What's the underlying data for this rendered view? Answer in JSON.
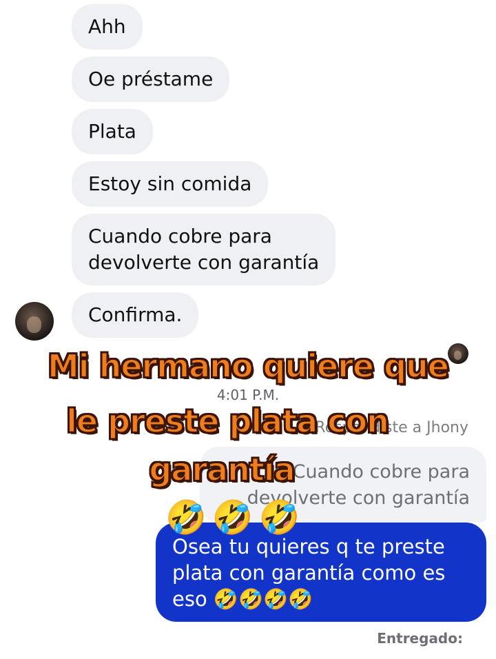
{
  "incoming_messages": [
    {
      "text": "Ahh"
    },
    {
      "text": "Oe préstame"
    },
    {
      "text": "Plata"
    },
    {
      "text": "Estoy sin comida"
    },
    {
      "text_line1": "Cuando cobre para",
      "text_line2": "devolverte con garantía"
    },
    {
      "text": "Confirma."
    }
  ],
  "timestamp": "4:01 P.M.",
  "reply": {
    "label": "↩ Respondiste a Jhony",
    "quote_line1": "Cuando cobre para",
    "quote_line2": "devolverte con garantía"
  },
  "outgoing": {
    "line1": "Osea tu quieres q te preste",
    "line2": "plata con garantía como es",
    "line3": "eso 🤣🤣🤣🤣"
  },
  "status": "Entregado:",
  "overlay": {
    "line1": "Mi hermano  quiere que",
    "line2": "le preste plata con",
    "line3": "garantía",
    "emojis": "🤣🤣🤣"
  },
  "colors": {
    "incoming_bubble": "#eef0f3",
    "outgoing_bubble": "#1234c8",
    "overlay_text": "#f07d1c"
  }
}
